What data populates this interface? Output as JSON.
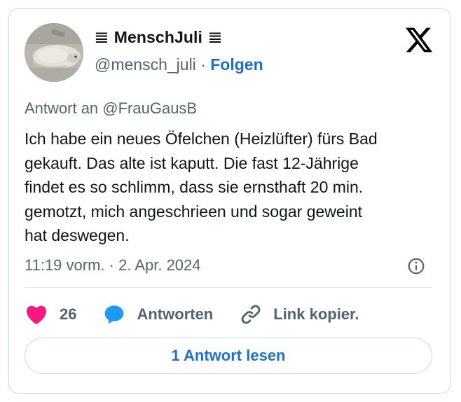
{
  "author": {
    "name": "MenschJuli",
    "name_glyph_left": "𝌆",
    "name_glyph_right": "𝌆",
    "handle": "@mensch_juli",
    "separator": "·",
    "follow_label": "Folgen"
  },
  "brand": {
    "logo_icon": "x-logo-icon",
    "logo_color": "#000000"
  },
  "tweet": {
    "reply_to": "Antwort an @FrauGausB",
    "text": "Ich habe ein neues Öfelchen (Heizlüfter) fürs Bad\ngekauft. Das alte ist kaputt. Die fast 12-Jährige\nfindet es so schlimm, dass sie ernsthaft 20 min.\ngemotzt, mich angeschrieen und sogar geweint\nhat deswegen.",
    "timestamp": "11:19 vorm. · 2. Apr. 2024"
  },
  "actions": {
    "like_count": "26",
    "reply_label": "Antworten",
    "copy_label": "Link kopier."
  },
  "read_replies_label": "1 Antwort lesen",
  "colors": {
    "accent": "#1d6fd1",
    "like": "#f91880",
    "reply_bubble": "#1d9bf0",
    "secondary_text": "#536471",
    "border": "#cfd9de"
  }
}
